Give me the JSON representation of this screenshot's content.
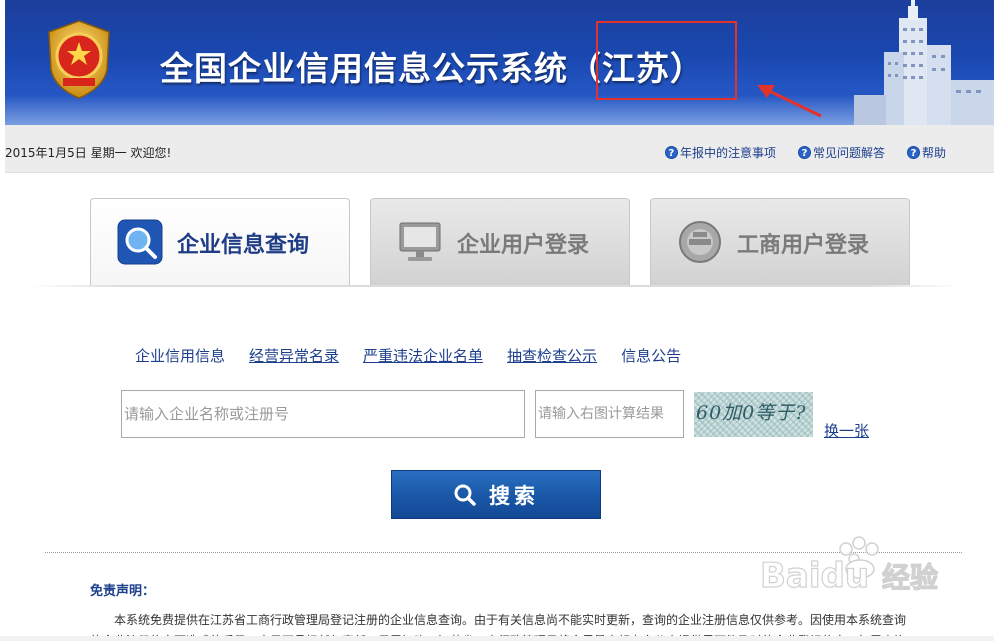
{
  "header": {
    "title": "全国企业信用信息公示系统（江苏）"
  },
  "infobar": {
    "date_greeting": "2015年1月5日 星期一   欢迎您!",
    "links": [
      {
        "label": "年报中的注意事项",
        "icon": "question-icon"
      },
      {
        "label": "常见问题解答",
        "icon": "question-icon"
      },
      {
        "label": "帮助",
        "icon": "question-icon"
      }
    ]
  },
  "tabs": [
    {
      "label": "企业信息查询",
      "icon": "magnifier-icon",
      "active": true
    },
    {
      "label": "企业用户登录",
      "icon": "monitor-icon",
      "active": false
    },
    {
      "label": "工商用户登录",
      "icon": "emblem-icon",
      "active": false
    }
  ],
  "categories": [
    {
      "label": "企业信用信息",
      "underline": false
    },
    {
      "label": "经营异常名录",
      "underline": true
    },
    {
      "label": "严重违法企业名单",
      "underline": true
    },
    {
      "label": "抽查检查公示",
      "underline": true
    },
    {
      "label": "信息公告",
      "underline": false
    }
  ],
  "search": {
    "name_placeholder": "请输入企业名称或注册号",
    "captcha_placeholder": "请输入右图计算结果",
    "captcha_text": "60加0等于?",
    "change_label": "换一张",
    "button_label": "搜索"
  },
  "disclaimer": {
    "title": "免责声明：",
    "text": "本系统免费提供在江苏省工商行政管理局登记注册的企业信息查询。由于有关信息尚不能实时更新，查询的企业注册信息仅供参考。因使用本系统查询的企业注册信息而造成的后果，本局不承担任何责任。另需知晓，江苏省工商行政管理局将会尽最大努力向公众提供尽可能及时的企业登记信息，如需查询"
  },
  "watermark": {
    "brand": "Baidu",
    "suffix": "经验"
  },
  "colors": {
    "header_blue": "#1a48b0",
    "link_blue": "#1d3f8c",
    "highlight_red": "#e2322c",
    "button_blue": "#1a58a8"
  }
}
